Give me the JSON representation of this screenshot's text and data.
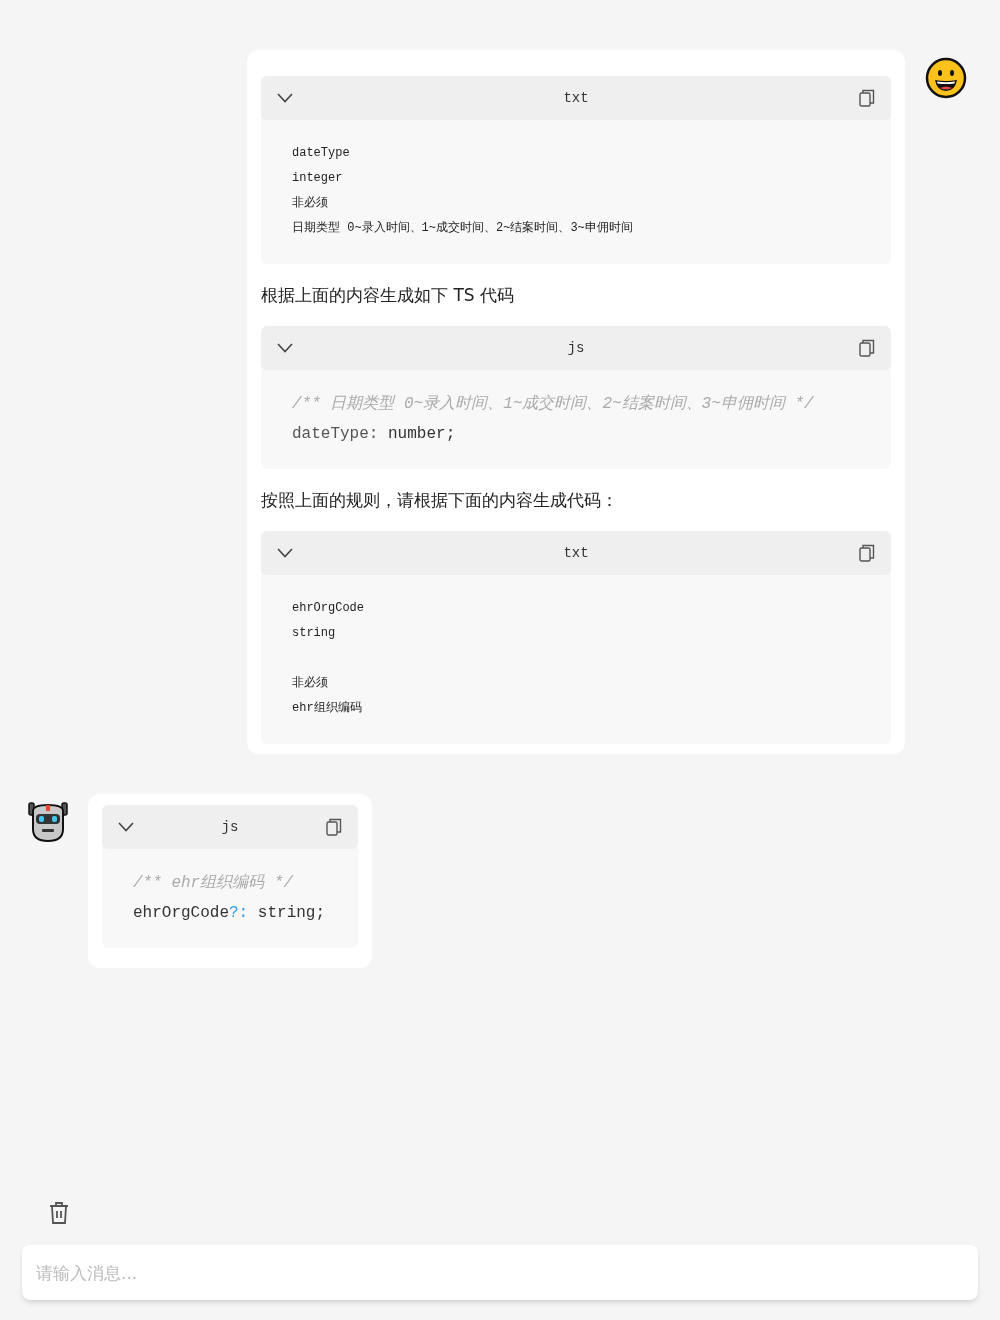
{
  "messages": [
    {
      "kind": "user",
      "parts": [
        {
          "kind": "code",
          "language": "txt",
          "lines": [
            {
              "kind": "plain",
              "text": "dateType"
            },
            {
              "kind": "plain",
              "text": "integer"
            },
            {
              "kind": "plain",
              "text": "非必须"
            },
            {
              "kind": "plain",
              "text": "日期类型 0~录入时间、1~成交时间、2~结案时间、3~申佣时间"
            }
          ]
        },
        {
          "kind": "text",
          "text": "根据上面的内容生成如下 TS 代码"
        },
        {
          "kind": "code",
          "language": "js",
          "lines": [
            {
              "kind": "comment",
              "text": "/** 日期类型 0~录入时间、1~成交时间、2~结案时间、3~申佣时间 */"
            },
            {
              "kind": "code",
              "tokens": [
                {
                  "kind": "property",
                  "text": "dateType: "
                },
                {
                  "kind": "plain",
                  "text": "number;"
                }
              ]
            }
          ]
        },
        {
          "kind": "text",
          "text": "按照上面的规则，请根据下面的内容生成代码："
        },
        {
          "kind": "code",
          "language": "txt",
          "lines": [
            {
              "kind": "plain",
              "text": "ehrOrgCode"
            },
            {
              "kind": "plain",
              "text": "string"
            },
            {
              "kind": "blank"
            },
            {
              "kind": "plain",
              "text": "非必须"
            },
            {
              "kind": "plain",
              "text": "ehr组织编码"
            }
          ]
        }
      ]
    },
    {
      "kind": "bot",
      "parts": [
        {
          "kind": "code",
          "language": "js",
          "lines": [
            {
              "kind": "comment",
              "text": "/** ehr组织编码 */"
            },
            {
              "kind": "code",
              "tokens": [
                {
                  "kind": "plain",
                  "text": "ehrOrgCode"
                },
                {
                  "kind": "punct",
                  "text": "?:"
                },
                {
                  "kind": "plain",
                  "text": " string;"
                }
              ]
            }
          ]
        }
      ]
    }
  ],
  "composer": {
    "placeholder": "请输入消息..."
  }
}
